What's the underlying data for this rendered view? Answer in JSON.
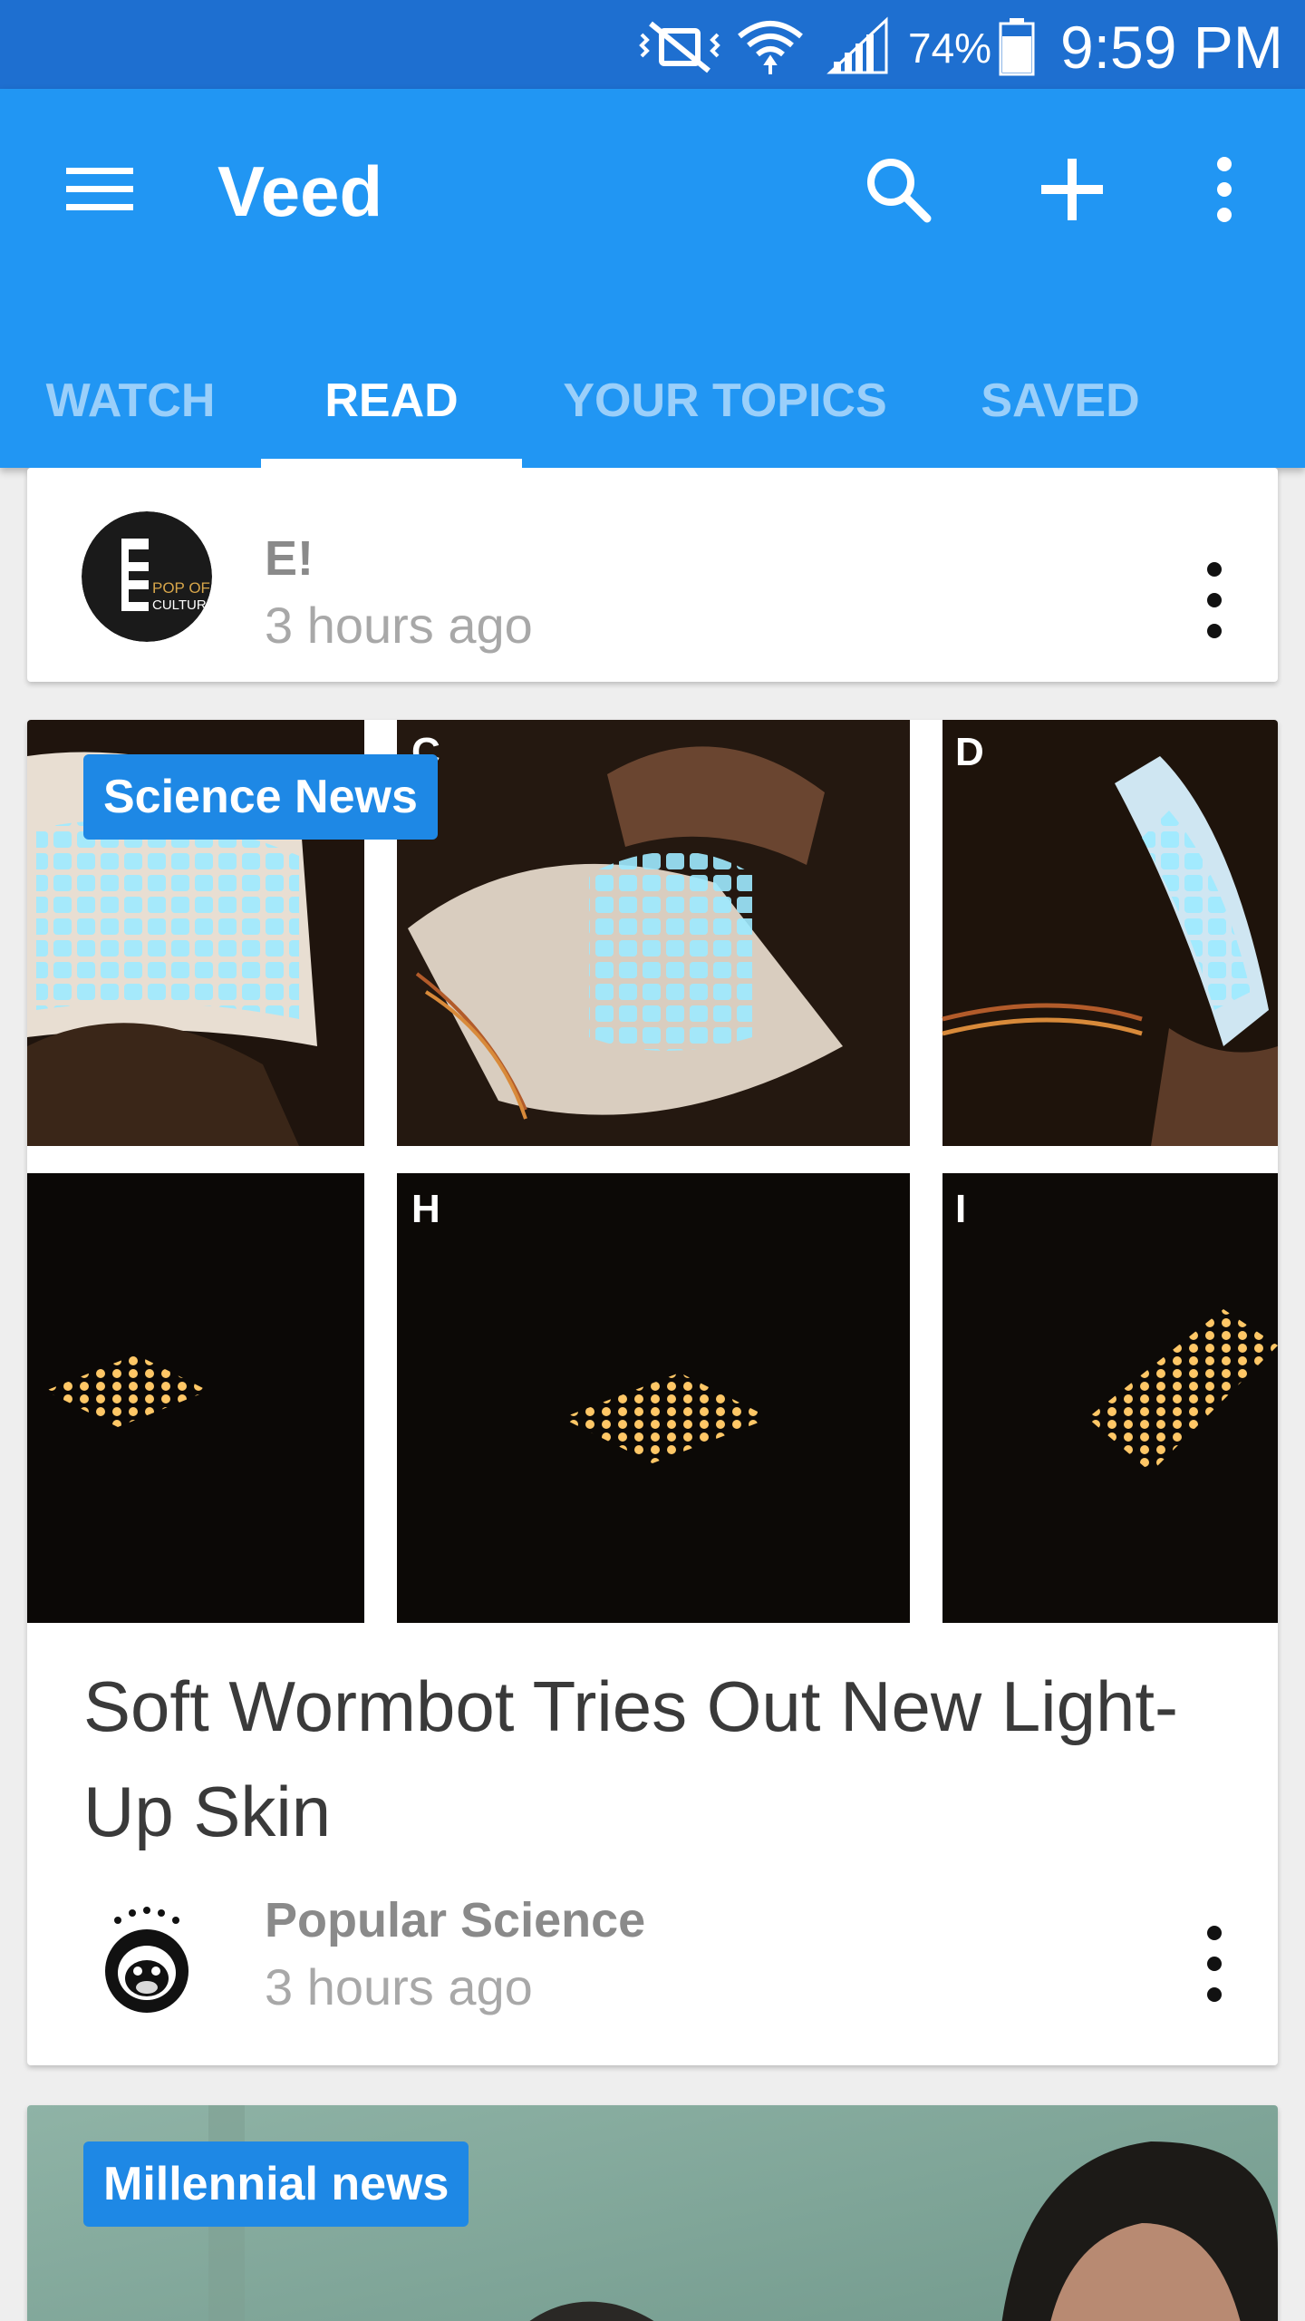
{
  "status_bar": {
    "battery_pct": "74%",
    "time": "9:59 PM",
    "icons": [
      "mute-vibrate-icon",
      "wifi-icon",
      "signal-icon",
      "battery-icon"
    ]
  },
  "app_bar": {
    "title": "Veed",
    "icons": [
      "menu-icon",
      "search-icon",
      "add-icon",
      "more-vert-icon"
    ],
    "color": "#2196f3"
  },
  "tabs": [
    {
      "label": "WATCH",
      "active": false
    },
    {
      "label": "READ",
      "active": true
    },
    {
      "label": "YOUR TOPICS",
      "active": false
    },
    {
      "label": "SAVED",
      "active": false
    }
  ],
  "cards": [
    {
      "source": "E!",
      "time": "3 hours ago",
      "avatar_text": {
        "letter": "E",
        "line1": "POP OF",
        "line2": "CULTURE"
      }
    },
    {
      "topic": "Science News",
      "image_labels": [
        "C",
        "D",
        "H",
        "I"
      ],
      "headline": "Soft Wormbot Tries Out New Light-Up Skin",
      "source": "Popular Science",
      "time": "3 hours ago"
    },
    {
      "topic": "Millennial news"
    }
  ]
}
